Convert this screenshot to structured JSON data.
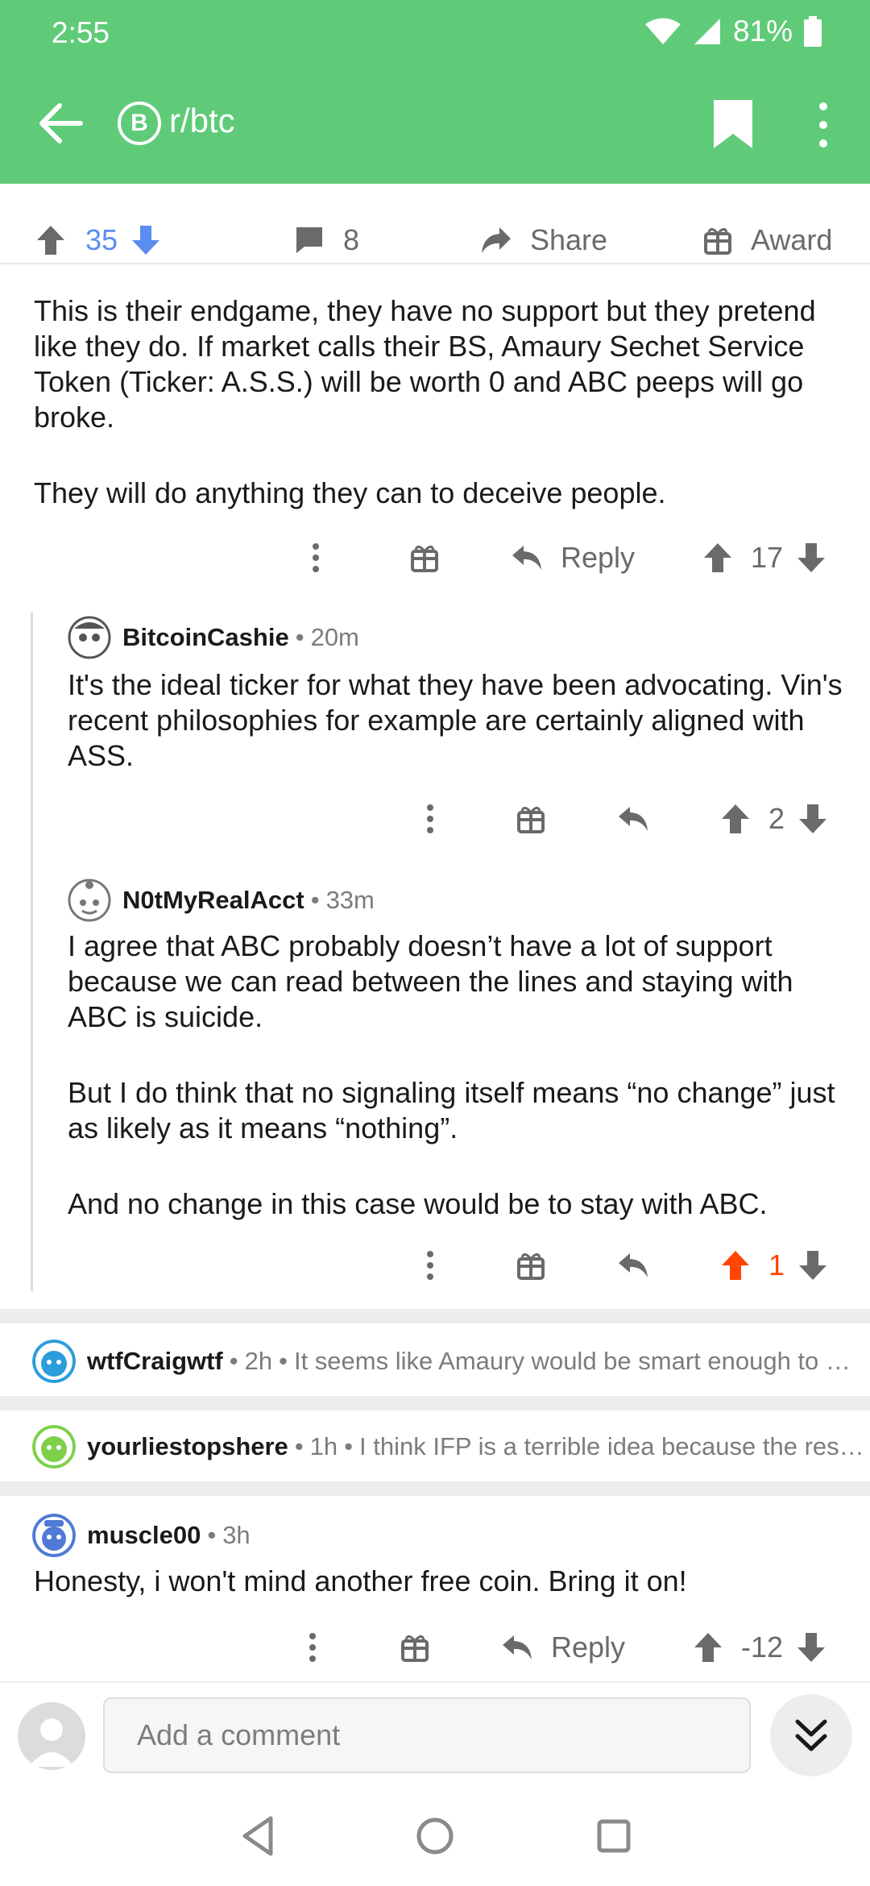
{
  "status_bar": {
    "time": "2:55",
    "battery": "81%"
  },
  "header": {
    "subreddit": "r/btc",
    "sub_icon_letter": "B"
  },
  "post_actions": {
    "score": "35",
    "comments": "8",
    "share_label": "Share",
    "award_label": "Award"
  },
  "comments": [
    {
      "paragraphs": [
        "This is their endgame, they have no support but they pretend like they do. If market calls their BS, Amaury Sechet Service Token (Ticker: A.S.S.) will be worth 0 and ABC peeps will go broke.",
        "They will do anything they can to deceive people."
      ],
      "reply_label": "Reply",
      "score": "17"
    },
    {
      "user": "BitcoinCashie",
      "age": "20m",
      "paragraphs": [
        "It's the ideal ticker for what they have been advocating. Vin's recent philosophies for example are certainly aligned with ASS."
      ],
      "score": "2"
    },
    {
      "user": "N0tMyRealAcct",
      "age": "33m",
      "paragraphs": [
        "I agree that ABC probably doesn’t have a lot of support because we can read between the lines and staying with ABC is suicide.",
        "But I do think that no signaling itself means “no change” just as likely as it means “nothing”.",
        "And no change in this case would be to stay with ABC."
      ],
      "score": "1",
      "upvoted_color": "#ff4500"
    }
  ],
  "collapsed": [
    {
      "user": "wtfCraigwtf",
      "age": "2h",
      "snippet": "It seems like Amaury would be smart enough to recognize this is a big"
    },
    {
      "user": "yourliestopshere",
      "age": "1h",
      "snippet": "I think IFP is a terrible idea because the rest of the"
    }
  ],
  "last_comment": {
    "user": "muscle00",
    "age": "3h",
    "text": "Honesty, i won't mind another free coin. Bring it on!",
    "reply_label": "Reply",
    "score": "-12"
  },
  "composer": {
    "placeholder": "Add a comment"
  },
  "colors": {
    "header_green": "#5fcb78",
    "upvote_active": "#ff4500",
    "vote_blue": "#5b8def"
  }
}
